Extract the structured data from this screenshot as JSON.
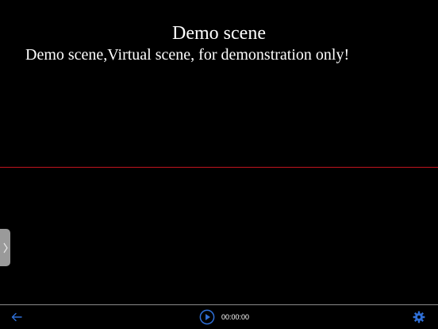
{
  "scene": {
    "title": "Demo scene",
    "subtitle": "Demo scene,Virtual scene, for demonstration only!"
  },
  "player": {
    "timecode": "00:00:00",
    "back_icon": "arrow-left-icon",
    "play_icon": "play-circle-icon",
    "settings_icon": "gear-icon",
    "handle_icon": "chevron-right-icon"
  },
  "colors": {
    "background": "#000000",
    "text": "#ffffff",
    "guide_line": "#c0141e",
    "accent_icon": "#2f6fd6",
    "handle": "#9a9a9a",
    "toolbar_border": "#8a8a8a"
  }
}
